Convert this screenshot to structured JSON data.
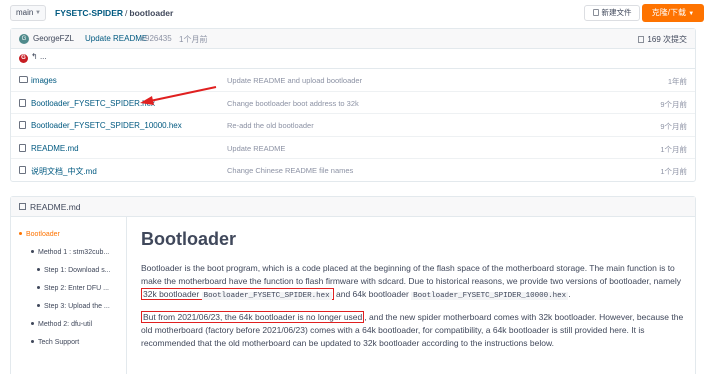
{
  "topbar": {
    "branch": "main",
    "repo_owner_path": "FYSETC-SPIDER",
    "separator": "/",
    "current_dir": "bootloader",
    "new_file_label": "新建文件",
    "clone_label": "克隆/下载",
    "colors": {
      "accent": "#fe7300",
      "link": "#005980"
    }
  },
  "commit": {
    "avatar_letter": "G",
    "author": "GeorgeFZL",
    "message": "Update README",
    "hash": "c926435",
    "time": "1个月前",
    "count": "169 次提交"
  },
  "back_row": {
    "logo_letter": "G",
    "label": "..."
  },
  "files": [
    {
      "type": "folder",
      "icon": "folder-icon",
      "name": "images",
      "message": "Update README and upload bootloader",
      "time": "1年前"
    },
    {
      "type": "file",
      "icon": "file-icon",
      "name": "Bootloader_FYSETC_SPIDER.hex",
      "message": "Change bootloader boot address to 32k",
      "time": "9个月前"
    },
    {
      "type": "file",
      "icon": "file-icon",
      "name": "Bootloader_FYSETC_SPIDER_10000.hex",
      "message": "Re-add the old bootloader",
      "time": "9个月前"
    },
    {
      "type": "file",
      "icon": "file-icon",
      "name": "README.md",
      "message": "Update README",
      "time": "1个月前"
    },
    {
      "type": "file",
      "icon": "file-icon",
      "name": "说明文档_中文.md",
      "message": "Change Chinese README file names",
      "time": "1个月前"
    }
  ],
  "readme": {
    "header": "README.md",
    "toc": [
      {
        "label": "Bootloader",
        "level": 0,
        "active": true
      },
      {
        "label": "Method 1 : stm32cub...",
        "level": 1,
        "active": false
      },
      {
        "label": "Step 1: Download s...",
        "level": 2,
        "active": false
      },
      {
        "label": "Step 2: Enter DFU ...",
        "level": 2,
        "active": false
      },
      {
        "label": "Step 3: Upload the ...",
        "level": 2,
        "active": false
      },
      {
        "label": "Method 2: dfu-util",
        "level": 1,
        "active": false
      },
      {
        "label": "Tech Support",
        "level": 1,
        "active": false
      }
    ],
    "title": "Bootloader",
    "p1_text": "Bootloader is the boot program, which is a code placed at the beginning of the flash space of the motherboard storage. The main function is to make the motherboard have the function to flash firmware with sdcard. Due to historical reasons, we provide two versions of bootloader, namely ",
    "p1_boxed": "32k bootloader ",
    "p1_code1": "Bootloader_FYSETC_SPIDER.hex",
    "p1_mid": " and 64k bootloader ",
    "p1_code2": "Bootloader_FYSETC_SPIDER_10000.hex",
    "p1_end": ".",
    "p2_boxed": "But from 2021/06/23, the 64k bootloader is no longer used",
    "p2_rest": ", and the new spider motherboard comes with 32k bootloader. However, because the old motherboard (factory before 2021/06/23) comes with a 64k bootloader, for compatibility, a 64k bootloader is still provided here. It is recommended that the old motherboard can be updated to 32k bootloader according to the instructions below."
  }
}
